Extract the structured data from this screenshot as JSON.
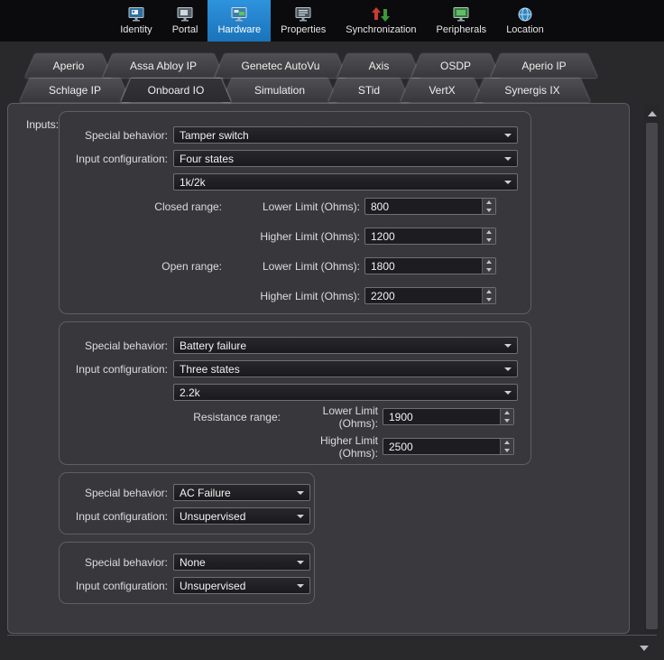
{
  "header": {
    "items": [
      {
        "label": "Identity"
      },
      {
        "label": "Portal"
      },
      {
        "label": "Hardware"
      },
      {
        "label": "Properties"
      },
      {
        "label": "Synchronization"
      },
      {
        "label": "Peripherals"
      },
      {
        "label": "Location"
      }
    ],
    "selected": "Hardware"
  },
  "tabs": {
    "row1": [
      {
        "label": "Aperio"
      },
      {
        "label": "Assa Abloy IP"
      },
      {
        "label": "Genetec AutoVu"
      },
      {
        "label": "Axis"
      },
      {
        "label": "OSDP"
      },
      {
        "label": "Aperio IP"
      }
    ],
    "row2": [
      {
        "label": "Schlage IP"
      },
      {
        "label": "Onboard IO"
      },
      {
        "label": "Simulation"
      },
      {
        "label": "STid"
      },
      {
        "label": "VertX"
      },
      {
        "label": "Synergis IX"
      }
    ],
    "selected": "Onboard IO"
  },
  "labels": {
    "inputs": "Inputs:",
    "special_behavior": "Special behavior:",
    "input_configuration": "Input configuration:",
    "closed_range": "Closed range:",
    "open_range": "Open range:",
    "resistance_range": "Resistance range:",
    "lower_limit": "Lower Limit (Ohms):",
    "higher_limit": "Higher Limit (Ohms):"
  },
  "groups": {
    "g1": {
      "special_behavior": "Tamper switch",
      "input_configuration": "Four states",
      "resistor": "1k/2k",
      "closed_lower": "800",
      "closed_higher": "1200",
      "open_lower": "1800",
      "open_higher": "2200"
    },
    "g2": {
      "special_behavior": "Battery failure",
      "input_configuration": "Three states",
      "resistor": "2.2k",
      "lower": "1900",
      "higher": "2500"
    },
    "g3": {
      "special_behavior": "AC Failure",
      "input_configuration": "Unsupervised"
    },
    "g4": {
      "special_behavior": "None",
      "input_configuration": "Unsupervised"
    }
  },
  "colors": {
    "accent": "#1d80cc",
    "sync_red": "#cc3a33",
    "sync_green": "#3a9a3a"
  }
}
